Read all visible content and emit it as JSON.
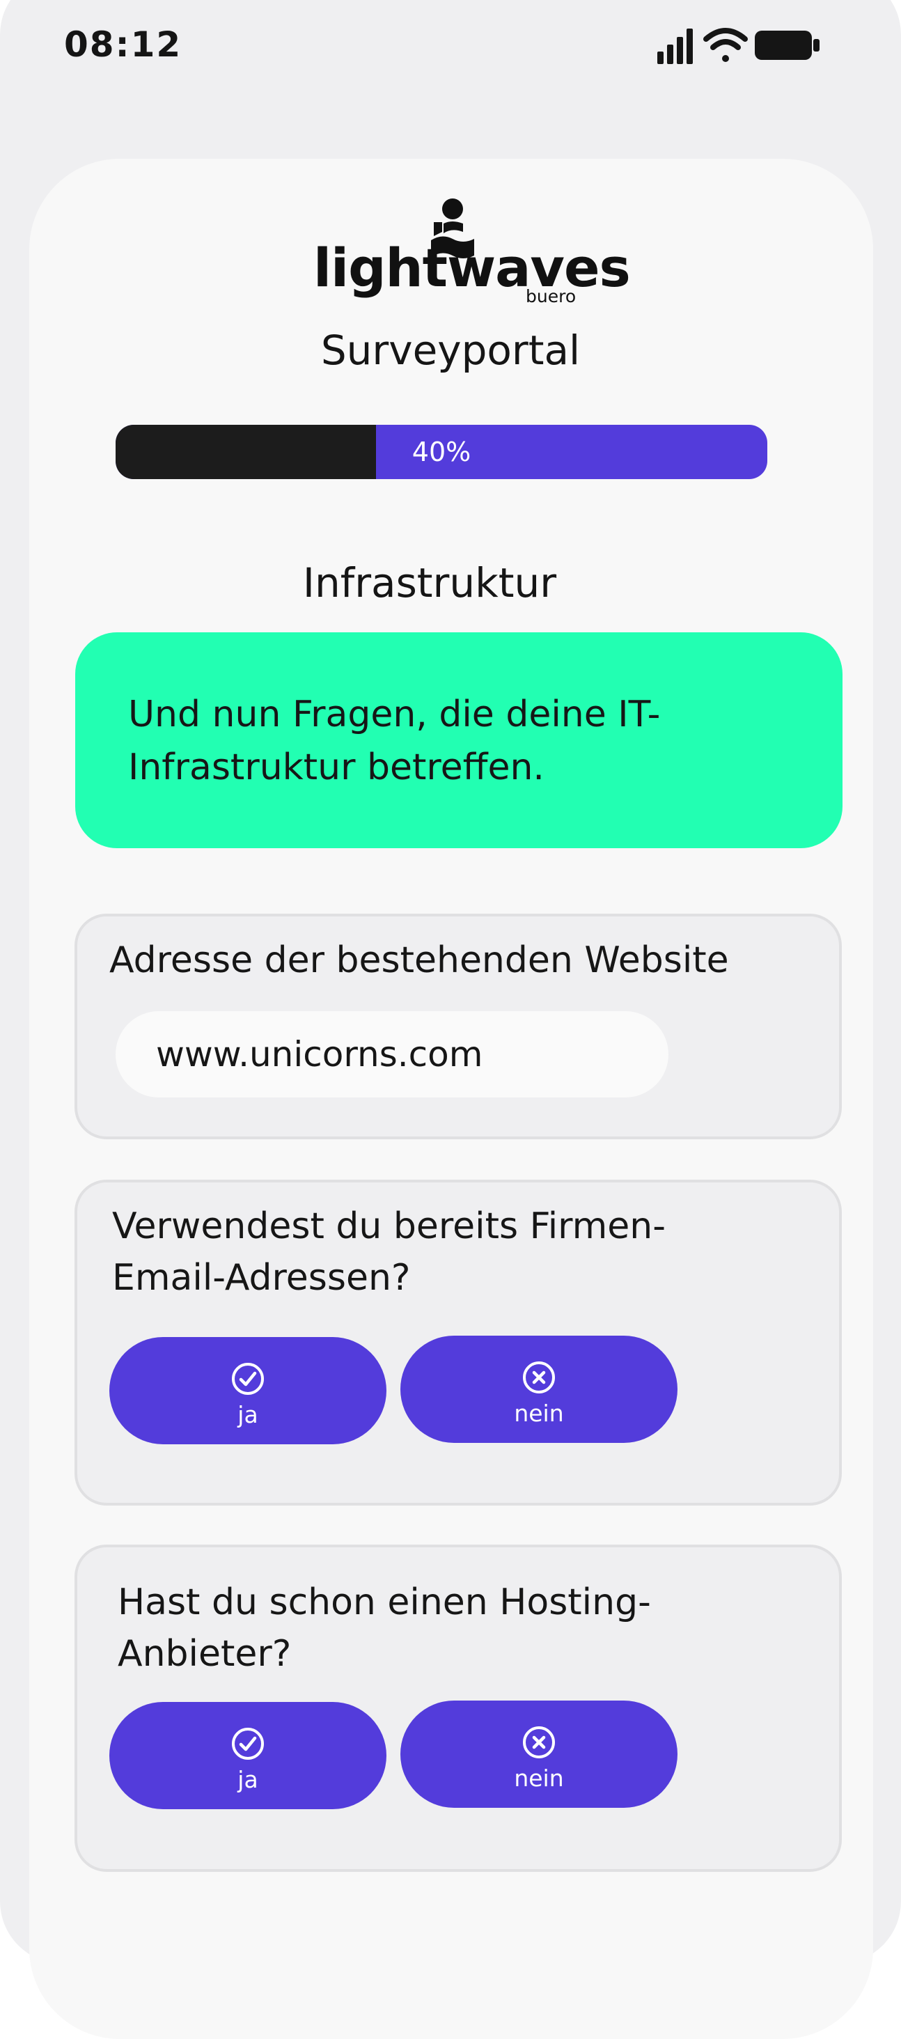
{
  "status_bar": {
    "time": "08:12",
    "icons": [
      "cellular-signal-icon",
      "wifi-icon",
      "battery-icon"
    ]
  },
  "logo": {
    "word": "lightwaves",
    "sub": "buero"
  },
  "header": {
    "title": "Surveyportal"
  },
  "progress": {
    "value_percent": 40,
    "label": "40%"
  },
  "section": {
    "title": "Infrastruktur",
    "intro": "Und nun Fragen, die deine IT-Infrastruktur betreffen."
  },
  "questions": [
    {
      "label": "Adresse der bestehenden Website",
      "input_value": "www.unicorns.com"
    },
    {
      "label": "Verwendest du bereits Firmen-Email-Adressen?",
      "yes_label": "ja",
      "no_label": "nein"
    },
    {
      "label": "Hast du schon einen Hosting-Anbieter?",
      "yes_label": "ja",
      "no_label": "nein"
    }
  ],
  "colors": {
    "accent": "#533cdb",
    "intro_background": "#22ffb2",
    "progress_fill": "#1c1c1c",
    "page_background": "#efeff1",
    "card_background": "#f8f8f8"
  }
}
